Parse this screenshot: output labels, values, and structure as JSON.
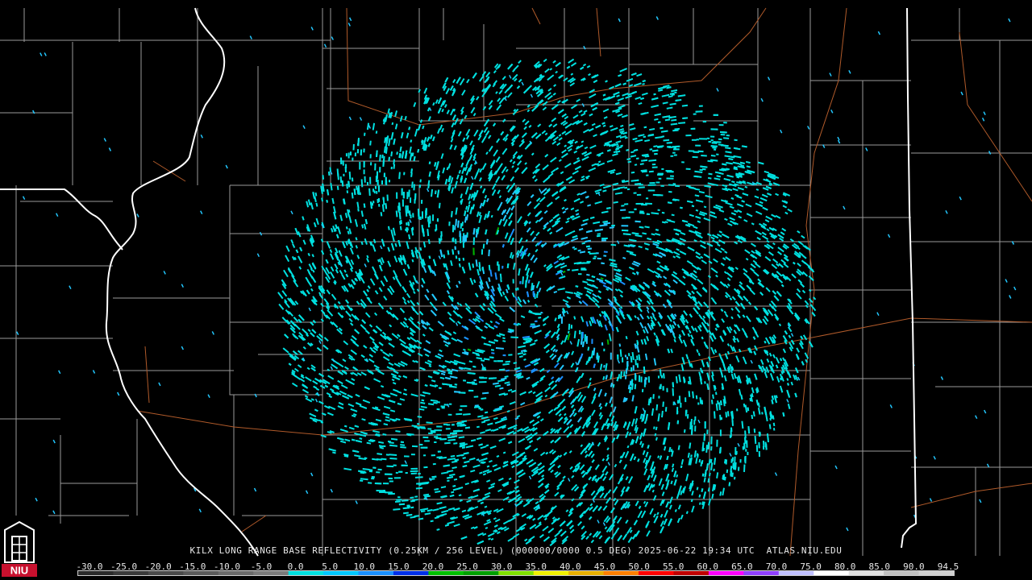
{
  "caption": {
    "text": "KILX LONG RANGE BASE REFLECTIVITY (0.25KM / 256 LEVEL) (000000/0000 0.5 DEG) 2025-06-22 19:34 UTC  ATLAS.NIU.EDU"
  },
  "logo": {
    "text": "NIU",
    "color": "#c8102e"
  },
  "colorbar": {
    "labels": [
      "-30.0",
      "-25.0",
      "-20.0",
      "-15.0",
      "-10.0",
      "-5.0",
      "0.0",
      "5.0",
      "10.0",
      "15.0",
      "20.0",
      "25.0",
      "30.0",
      "35.0",
      "40.0",
      "45.0",
      "50.0",
      "55.0",
      "60.0",
      "65.0",
      "70.0",
      "75.0",
      "80.0",
      "85.0",
      "90.0",
      "94.5"
    ],
    "colors": [
      "#2a2a2a",
      "#3a3a3a",
      "#4a4a4a",
      "#5a5a5a",
      "#6a6a6a",
      "#7a7a7a",
      "#00e0e0",
      "#00c8ff",
      "#1a90ff",
      "#0030e8",
      "#00c000",
      "#00a000",
      "#80e000",
      "#f0f000",
      "#e8b000",
      "#ff8000",
      "#ff0000",
      "#c00000",
      "#ff00ff",
      "#9040ff",
      "#c0c0ff",
      "#ffffff",
      "#e0e0e0",
      "#c0c0c0",
      "#d0d0d0"
    ]
  },
  "map": {
    "state_line_color": "#ffffff",
    "county_line_color": "#9a9a9a",
    "road_color": "#b05a2a",
    "echo_colors": [
      "#00e0e0",
      "#22c8ff",
      "#1a90ff",
      "#00b000"
    ]
  }
}
